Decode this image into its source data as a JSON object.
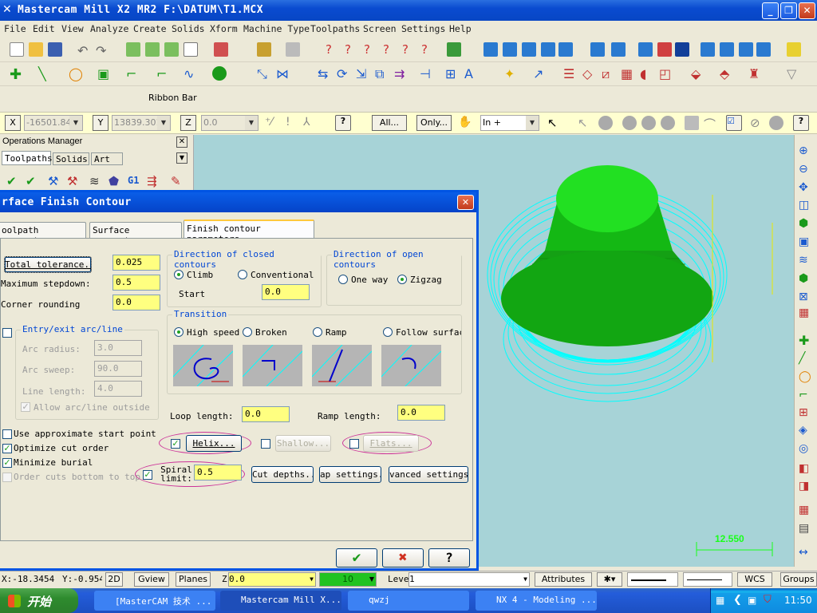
{
  "window": {
    "title": "Mastercam Mill X2 MR2  F:\\DATUM\\T1.MCX"
  },
  "menu": [
    "File",
    "Edit",
    "View",
    "Analyze",
    "Create",
    "Solids",
    "Xform",
    "Machine Type",
    "Toolpaths",
    "Screen",
    "Settings",
    "Help"
  ],
  "ribbon_label": "Ribbon Bar",
  "coords": {
    "x_label": "X",
    "x_value": "-16501.84",
    "y_label": "Y",
    "y_value": "13839.301",
    "z_label": "Z",
    "z_value": "0.0",
    "all_btn": "All...",
    "only_btn": "Only...",
    "select_mode": "In +"
  },
  "ops_manager": {
    "title": "Operations Manager",
    "tabs": [
      "Toolpaths",
      "Solids",
      "Art"
    ],
    "g1": "G1"
  },
  "dialog": {
    "title": "rface Finish Contour",
    "tabs": [
      "oolpath parameters",
      "Surface parameters",
      "Finish contour parameters"
    ],
    "total_tolerance_btn": "Total tolerance...",
    "total_tolerance": "0.025",
    "max_stepdown_label": "Maximum stepdown:",
    "max_stepdown": "0.5",
    "corner_rounding_label": "Corner rounding",
    "corner_rounding": "0.0",
    "entry_exit": {
      "title": "Entry/exit arc/line",
      "arc_radius_label": "Arc radius:",
      "arc_radius": "3.0",
      "arc_sweep_label": "Arc sweep:",
      "arc_sweep": "90.0",
      "line_length_label": "Line length:",
      "line_length": "4.0",
      "allow_label": "Allow arc/line outside bo"
    },
    "closed": {
      "title": "Direction of closed contours",
      "climb": "Climb",
      "conventional": "Conventional",
      "start_label": "Start",
      "start": "0.0"
    },
    "open": {
      "title": "Direction of open contours",
      "one_way": "One way",
      "zigzag": "Zigzag"
    },
    "transition": {
      "title": "Transition",
      "high_speed": "High speed",
      "broken": "Broken",
      "ramp": "Ramp",
      "follow": "Follow surfac"
    },
    "loop_length_label": "Loop length:",
    "loop_length": "0.0",
    "ramp_length_label": "Ramp length:",
    "ramp_length": "0.0",
    "use_approx": "Use approximate start point",
    "optimize": "Optimize cut order",
    "minimize": "Minimize burial",
    "order_cuts": "Order cuts bottom to top",
    "helix_btn": "Helix...",
    "shallow_btn": "Shallow...",
    "flats_btn": "Flats...",
    "spiral_label": "Spiral limit:",
    "spiral_limit": "0.5",
    "cut_depths_btn": "Cut depths...",
    "gap_settings_btn": "ap settings...",
    "advanced_btn": "vanced settings..."
  },
  "graphics": {
    "scale_label": "12.550"
  },
  "status": {
    "x": "X:-18.3454",
    "y": "Y:-0.954",
    "mode2d": "2D",
    "gview": "Gview",
    "planes": "Planes",
    "z_label": "Z",
    "z": "0.0",
    "level_num": "10",
    "level_label": "Level",
    "level_val": "1",
    "attributes": "Attributes",
    "wcs": "WCS",
    "groups": "Groups"
  },
  "taskbar": {
    "start": "开始",
    "tasks": [
      "[MasterCAM 技术 ...",
      "Mastercam Mill X...",
      "qwzj",
      "NX 4 - Modeling ..."
    ],
    "clock": "11:50"
  },
  "colors": {
    "accent": "#0054e3",
    "field_yellow": "#ffff80",
    "model_green": "#22c022",
    "toolpath_cyan": "#00ffff",
    "highlight_ellipse": "#cc3399"
  }
}
